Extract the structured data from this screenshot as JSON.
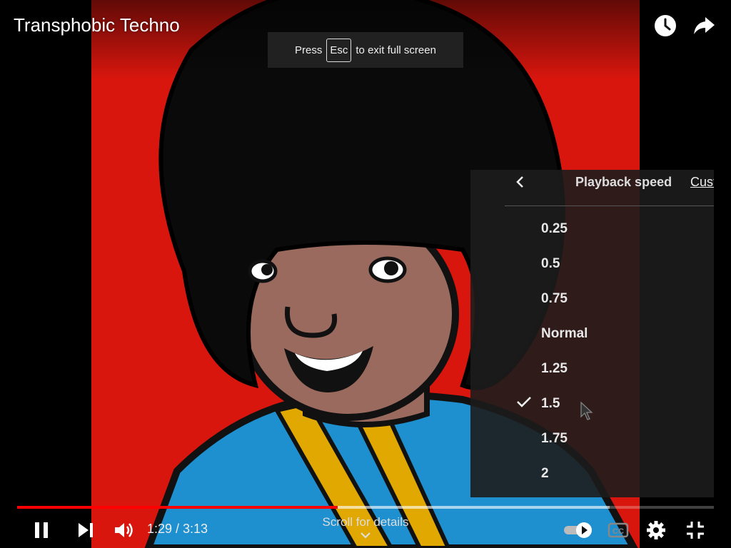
{
  "video": {
    "title": "Transphobic Techno"
  },
  "top_actions": {
    "watch_later_icon": "clock-icon",
    "share_icon": "share-arrow-icon"
  },
  "fullscreen_hint": {
    "prefix": "Press",
    "key": "Esc",
    "suffix": "to exit full screen"
  },
  "speed_menu": {
    "title": "Playback speed",
    "custom_label": "Cust",
    "back_icon": "chevron-left-icon",
    "options": [
      "0.25",
      "0.5",
      "0.75",
      "Normal",
      "1.25",
      "1.5",
      "1.75",
      "2"
    ],
    "selected": "1.5"
  },
  "player": {
    "current_time": "1:29",
    "duration": "3:13",
    "time_display": "1:29 / 3:13",
    "progress_fraction": 0.46,
    "buffered_fraction": 0.85,
    "scroll_hint": "Scroll for details",
    "colors": {
      "played": "#ff0000",
      "background": "#d8160e"
    }
  }
}
